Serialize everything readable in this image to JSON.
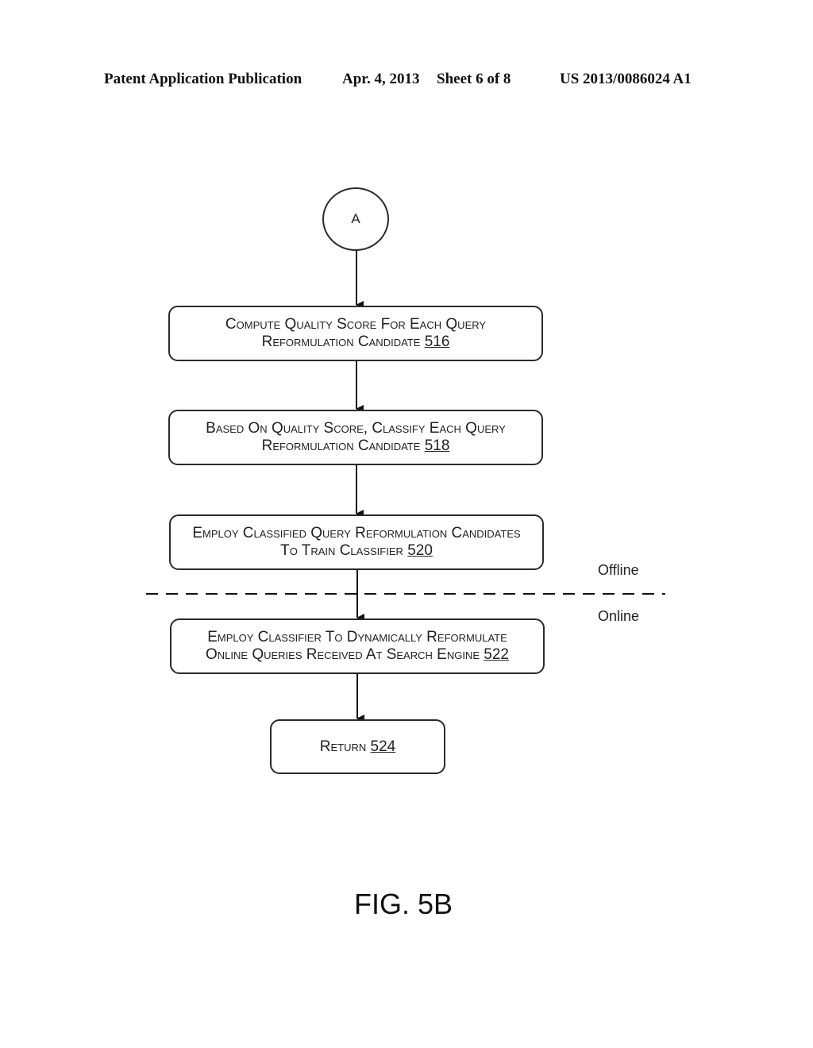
{
  "header": {
    "publication": "Patent Application Publication",
    "date": "Apr. 4, 2013",
    "sheet": "Sheet 6 of 8",
    "number": "US 2013/0086024 A1"
  },
  "connector": {
    "label": "A"
  },
  "steps": [
    {
      "line1": "Compute Quality Score For Each Query",
      "line2": "Reformulation Candidate",
      "ref": "516"
    },
    {
      "line1": "Based On Quality Score, Classify Each Query",
      "line2": "Reformulation Candidate",
      "ref": "518"
    },
    {
      "line1": "Employ Classified Query Reformulation Candidates",
      "line2": "To Train Classifier",
      "ref": "520"
    },
    {
      "line1": "Employ Classifier To Dynamically Reformulate",
      "line2": "Online Queries Received At Search Engine",
      "ref": "522"
    },
    {
      "line1": "",
      "line2": "Return",
      "ref": "524"
    }
  ],
  "divider": {
    "above_label": "Offline",
    "below_label": "Online"
  },
  "figure_label": "FIG. 5B"
}
